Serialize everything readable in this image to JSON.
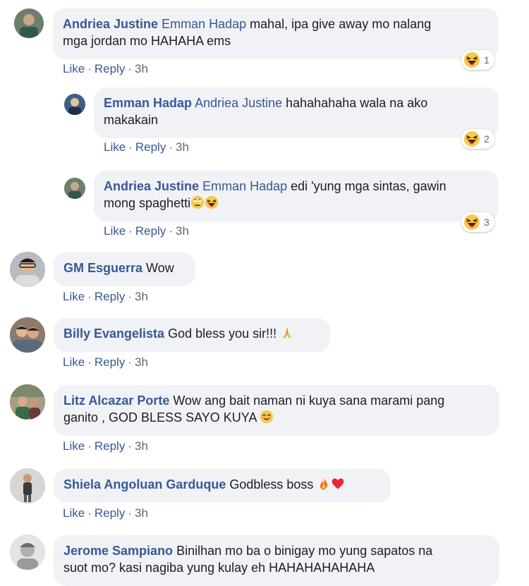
{
  "comments": [
    {
      "author": "Andriea Justine",
      "mention": "Emman Hadap",
      "text_l1": " mahal, ipa give away mo nalang",
      "text_l2": "mga jordan mo HAHAHA ems",
      "reaction_count": "1",
      "like": "Like",
      "reply": "Reply",
      "time": "3h"
    },
    {
      "author": "Emman Hadap",
      "mention": "Andriea Justine",
      "text_l1": " hahahahaha wala na ako",
      "text_l2": "makakain",
      "reaction_count": "2",
      "like": "Like",
      "reply": "Reply",
      "time": "3h"
    },
    {
      "author": "Andriea Justine",
      "mention": "Emman Hadap",
      "text_l1": " edi 'yung mga sintas, gawin",
      "text_l2": "mong spaghetti",
      "reaction_count": "3",
      "like": "Like",
      "reply": "Reply",
      "time": "3h"
    },
    {
      "author": "GM Esguerra",
      "text_l1": " Wow",
      "like": "Like",
      "reply": "Reply",
      "time": "3h"
    },
    {
      "author": "Billy Evangelista",
      "text_l1": " God bless you sir!!! ",
      "like": "Like",
      "reply": "Reply",
      "time": "3h"
    },
    {
      "author": "Litz Alcazar Porte",
      "text_l1": " Wow ang bait naman ni kuya sana marami pang",
      "text_l2": "ganito , GOD BLESS SAYO KUYA ",
      "like": "Like",
      "reply": "Reply",
      "time": "3h"
    },
    {
      "author": "Shiela Angoluan Garduque",
      "text_l1": " Godbless boss ",
      "like": "Like",
      "reply": "Reply",
      "time": "3h"
    },
    {
      "author": "Jerome Sampiano",
      "text_l1": " Binilhan mo ba o binigay mo yung sapatos na",
      "text_l2": "suot mo? kasi nagiba yung kulay eh HAHAHAHAHAHA"
    }
  ],
  "colors": {
    "link": "#385898",
    "bubble": "#f0f2f5",
    "meta": "#606770"
  }
}
